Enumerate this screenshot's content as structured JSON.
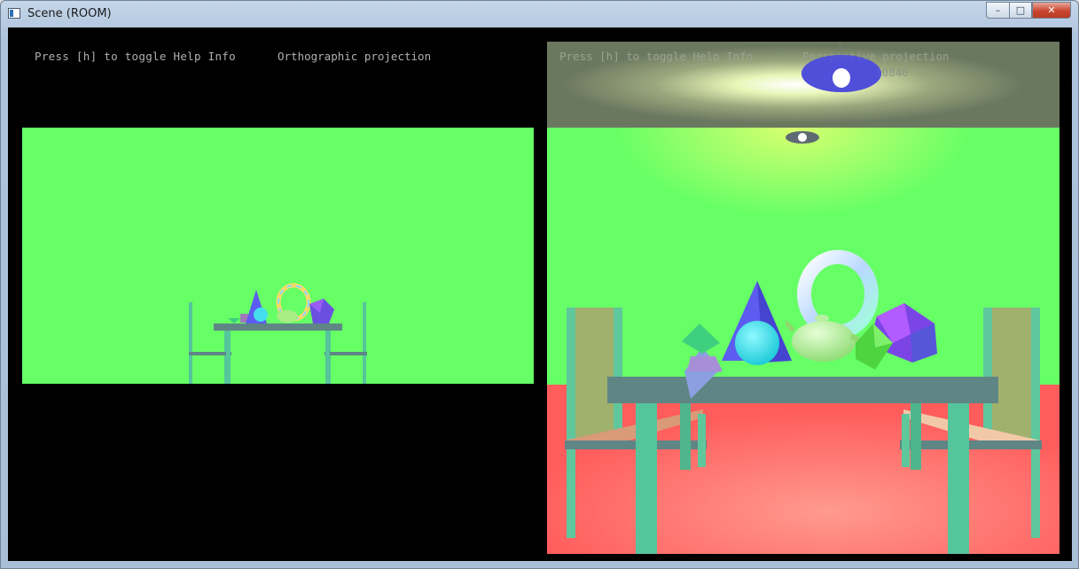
{
  "window": {
    "title": "Scene (ROOM)",
    "buttons": {
      "minimize": "–",
      "maximize": "□",
      "close": "✕"
    }
  },
  "left_view": {
    "help_text": "Press [h] to toggle Help Info",
    "projection": "Orthographic projection"
  },
  "right_view": {
    "help_text": "Press [h] to toggle Help Info",
    "projection": "Perspective projection",
    "fps_fragment": "10840"
  },
  "colors": {
    "wall": "#66ff66",
    "floor": "#ff6060",
    "ceiling": "#6e7c62",
    "table_top": "#5f8585",
    "table_legs": "#55c59b",
    "chair_seat": "#d99a7a",
    "chair_back": "#a0b06d",
    "cone": "#5c5cf0",
    "sphere": "#33e6f0",
    "teapot": "#9fe67f",
    "lamp_shade": "#4f4fd9",
    "background": "#000000"
  },
  "icons": {
    "app": "window-icon"
  }
}
